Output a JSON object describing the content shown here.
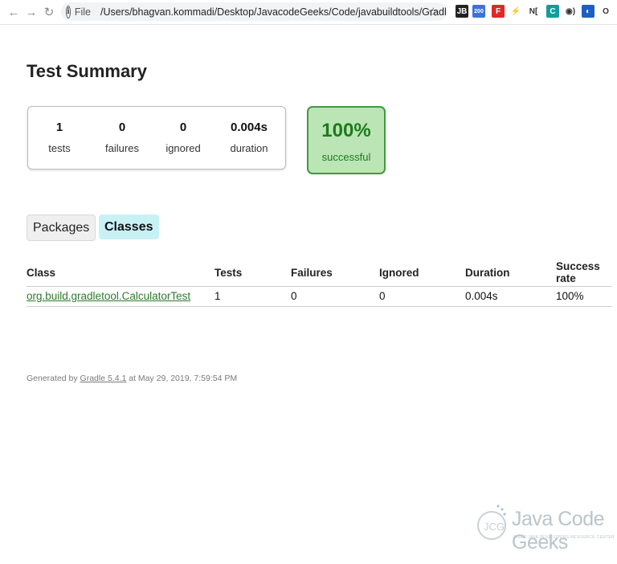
{
  "browser": {
    "url_scheme": "File",
    "url_path": "/Users/bhagvan.kommadi/Desktop/JavacodeGeeks/Code/javabuildtools/GradleHello/bu...",
    "extensions": [
      {
        "name": "jb-extension-icon",
        "glyph": "JB",
        "bg": "#222222",
        "fg": "#ffffff"
      },
      {
        "name": "rss-extension-icon",
        "glyph": "200",
        "bg": "#3b74d6",
        "fg": "#ffffff"
      },
      {
        "name": "flipboard-extension-icon",
        "glyph": "F",
        "bg": "#e02828",
        "fg": "#ffffff"
      },
      {
        "name": "lightning-extension-icon",
        "glyph": "⚡",
        "bg": "#ffffff",
        "fg": "#333333"
      },
      {
        "name": "notion-extension-icon",
        "glyph": "N[",
        "bg": "#ffffff",
        "fg": "#333333"
      },
      {
        "name": "c-extension-icon",
        "glyph": "C",
        "bg": "#0f9d9d",
        "fg": "#ffffff"
      },
      {
        "name": "broadcast-extension-icon",
        "glyph": "◉)",
        "bg": "#ffffff",
        "fg": "#333333"
      },
      {
        "name": "compass-extension-icon",
        "glyph": "◐",
        "bg": "#1f5fbf",
        "fg": "#ffffff"
      },
      {
        "name": "circle-extension-icon",
        "glyph": "O",
        "bg": "#ffffff",
        "fg": "#333333"
      }
    ]
  },
  "page": {
    "title": "Test Summary",
    "counters": [
      {
        "value": "1",
        "label": "tests"
      },
      {
        "value": "0",
        "label": "failures"
      },
      {
        "value": "0",
        "label": "ignored"
      },
      {
        "value": "0.004s",
        "label": "duration"
      }
    ],
    "success": {
      "percent": "100%",
      "label": "successful"
    },
    "tabs": {
      "packages": "Packages",
      "classes": "Classes"
    },
    "table": {
      "headers": [
        "Class",
        "Tests",
        "Failures",
        "Ignored",
        "Duration",
        "Success rate"
      ],
      "rows": [
        {
          "class": "org.build.gradletool.CalculatorTest",
          "tests": "1",
          "failures": "0",
          "ignored": "0",
          "duration": "0.004s",
          "success_rate": "100%"
        }
      ]
    },
    "footer": {
      "prefix": "Generated by ",
      "link": "Gradle 5.4.1",
      "suffix": " at May 29, 2019, 7:59:54 PM"
    }
  },
  "watermark": {
    "title": "Java Code Geeks",
    "subtitle": "JAVA 2 JAVA DEVELOPERS RESOURCE CENTER"
  },
  "colors": {
    "success_bg": "#bbe5b5",
    "success_border": "#3f9b3f",
    "success_text": "#1e7a1e",
    "active_tab_bg": "#c8f1f6"
  }
}
